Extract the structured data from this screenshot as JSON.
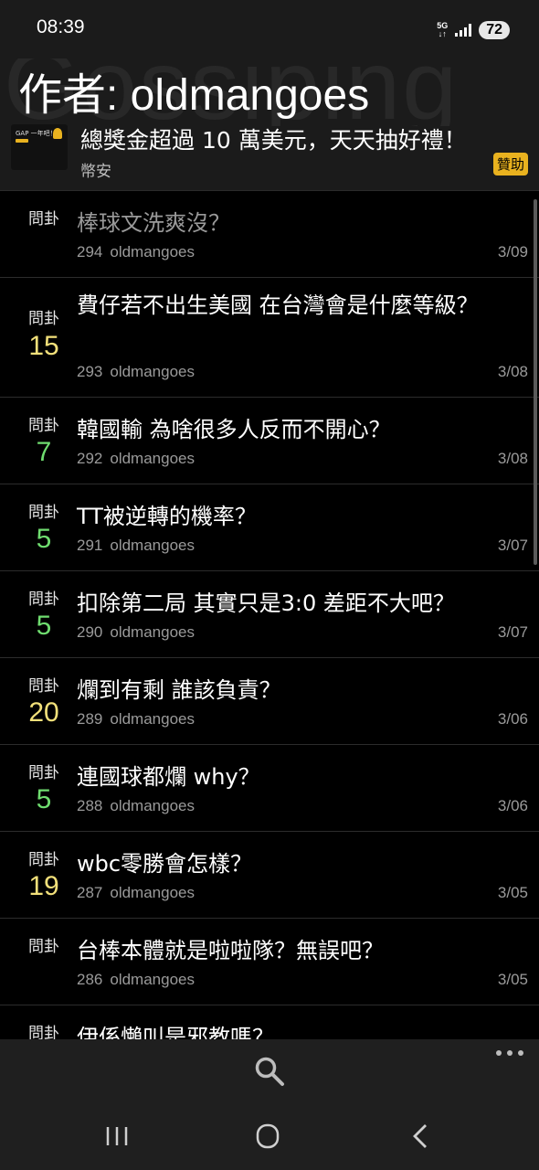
{
  "status_bar": {
    "time": "08:39",
    "network": "5G",
    "battery": "72"
  },
  "header": {
    "title": "作者: oldmangoes",
    "watermark": "Gossiping"
  },
  "ad": {
    "thumb_text": "GAP 一年吧！",
    "title": "總獎金超過 10 萬美元，天天抽好禮！",
    "source": "幣安",
    "badge": "贊助"
  },
  "posts": [
    {
      "category": "問卦",
      "count": "",
      "count_color": "",
      "title": "棒球文洗爽沒？",
      "read": true,
      "id": "294",
      "author": "oldmangoes",
      "date": "3/09"
    },
    {
      "category": "問卦",
      "count": "15",
      "count_color": "yellow",
      "title": "費仔若不出生美國 在台灣會是什麼等級？",
      "read": false,
      "id": "293",
      "author": "oldmangoes",
      "date": "3/08"
    },
    {
      "category": "問卦",
      "count": "7",
      "count_color": "green",
      "title": "韓國輸 為啥很多人反而不開心？",
      "read": false,
      "id": "292",
      "author": "oldmangoes",
      "date": "3/08"
    },
    {
      "category": "問卦",
      "count": "5",
      "count_color": "green",
      "title": "TT被逆轉的機率？",
      "read": false,
      "id": "291",
      "author": "oldmangoes",
      "date": "3/07"
    },
    {
      "category": "問卦",
      "count": "5",
      "count_color": "green",
      "title": "扣除第二局 其實只是3:0 差距不大吧？",
      "read": false,
      "id": "290",
      "author": "oldmangoes",
      "date": "3/07"
    },
    {
      "category": "問卦",
      "count": "20",
      "count_color": "yellow",
      "title": "爛到有剩 誰該負責？",
      "read": false,
      "id": "289",
      "author": "oldmangoes",
      "date": "3/06"
    },
    {
      "category": "問卦",
      "count": "5",
      "count_color": "green",
      "title": "連國球都爛 why？",
      "read": false,
      "id": "288",
      "author": "oldmangoes",
      "date": "3/06"
    },
    {
      "category": "問卦",
      "count": "19",
      "count_color": "yellow",
      "title": "wbc零勝會怎樣？",
      "read": false,
      "id": "287",
      "author": "oldmangoes",
      "date": "3/05"
    },
    {
      "category": "問卦",
      "count": "",
      "count_color": "",
      "title": "台棒本體就是啦啦隊？無誤吧？",
      "read": false,
      "id": "286",
      "author": "oldmangoes",
      "date": "3/05"
    },
    {
      "category": "問卦",
      "count": "",
      "count_color": "",
      "title": "伊係懶叫是邪教嗎？",
      "read": false,
      "id": "",
      "author": "",
      "date": ""
    }
  ],
  "toolbar": {
    "search_icon": "search-icon",
    "more_icon": "more-icon"
  },
  "navbar": {
    "recents_icon": "recents-icon",
    "home_icon": "home-icon",
    "back_icon": "back-icon"
  }
}
